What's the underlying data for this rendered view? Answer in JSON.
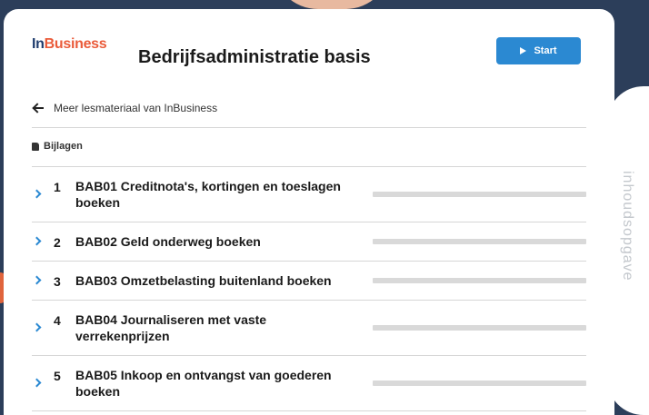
{
  "brand": {
    "logo_in": "In",
    "logo_business": "Business"
  },
  "course_title": "Bedrijfsadministratie basis",
  "start_button": {
    "label": "Start"
  },
  "back_link": {
    "label": "Meer lesmateriaal van InBusiness"
  },
  "attachments": {
    "label": "Bijlagen"
  },
  "side_tab": {
    "label": "inhoudsopgave"
  },
  "chapters": [
    {
      "number": "1",
      "title": "BAB01 Creditnota's, kortingen en toeslagen boeken",
      "progress": 0
    },
    {
      "number": "2",
      "title": "BAB02 Geld onderweg boeken",
      "progress": 0
    },
    {
      "number": "3",
      "title": "BAB03 Omzetbelasting buitenland boeken",
      "progress": 0
    },
    {
      "number": "4",
      "title": "BAB04 Journaliseren met vaste verrekenprijzen",
      "progress": 0
    },
    {
      "number": "5",
      "title": "BAB05 Inkoop en ontvangst van goederen boeken",
      "progress": 0
    }
  ],
  "colors": {
    "accent": "#2b89d2",
    "brand_dark": "#1f3c6e",
    "brand_orange": "#ea5b3a",
    "page_background": "#2c3e5a"
  }
}
